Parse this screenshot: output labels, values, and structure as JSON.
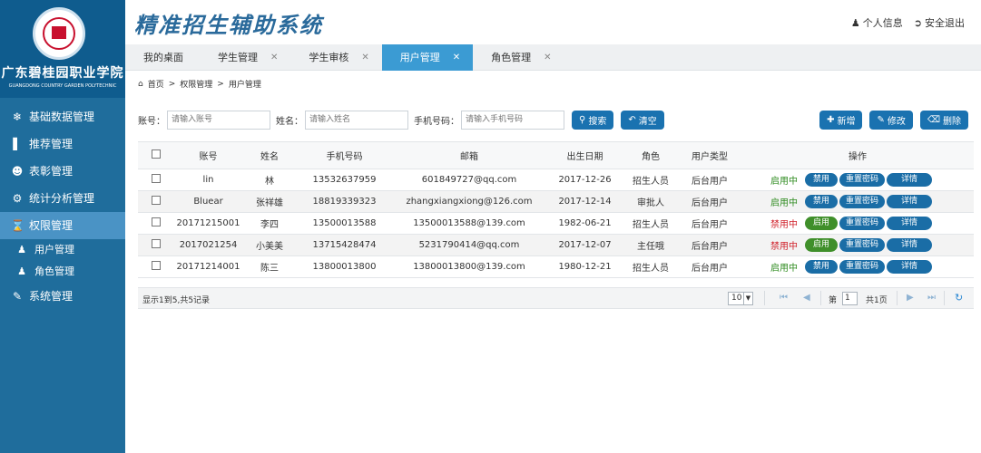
{
  "app": {
    "title": "精准招生辅助系统",
    "logo_cn": "广东碧桂园职业学院",
    "logo_en": "GUANGDONG COUNTRY GARDEN POLYTECHNIC"
  },
  "header": {
    "profile": "个人信息",
    "logout": "安全退出"
  },
  "sidebar": {
    "items": [
      {
        "label": "基础数据管理",
        "icon": "globe-icon"
      },
      {
        "label": "推荐管理",
        "icon": "bar-chart-icon"
      },
      {
        "label": "表彰管理",
        "icon": "users-icon"
      },
      {
        "label": "统计分析管理",
        "icon": "gear-icon"
      },
      {
        "label": "权限管理",
        "icon": "hourglass-icon"
      }
    ],
    "subitems": [
      {
        "label": "用户管理",
        "icon": "user-icon"
      },
      {
        "label": "角色管理",
        "icon": "user-edit-icon"
      }
    ],
    "last": {
      "label": "系统管理",
      "icon": "edit-icon"
    }
  },
  "tabs": [
    {
      "label": "我的桌面",
      "closable": false
    },
    {
      "label": "学生管理",
      "closable": true
    },
    {
      "label": "学生审核",
      "closable": true
    },
    {
      "label": "用户管理",
      "closable": true,
      "active": true
    },
    {
      "label": "角色管理",
      "closable": true
    }
  ],
  "breadcrumb": [
    "首页",
    "权限管理",
    "用户管理"
  ],
  "search": {
    "account_label": "账号：",
    "account_placeholder": "请输入账号",
    "name_label": "姓名：",
    "name_placeholder": "请输入姓名",
    "phone_label": "手机号码：",
    "phone_placeholder": "请输入手机号码",
    "search_btn": "搜索",
    "clear_btn": "清空",
    "add_btn": "新增",
    "edit_btn": "修改",
    "delete_btn": "删除"
  },
  "table": {
    "headers": [
      "账号",
      "姓名",
      "手机号码",
      "邮箱",
      "出生日期",
      "角色",
      "用户类型",
      "操作"
    ],
    "rows": [
      {
        "account": "lin",
        "name": "林",
        "phone": "13532637959",
        "email": "601849727@qq.com",
        "birth": "2017-12-26",
        "role": "招生人员",
        "type": "后台用户",
        "status": "启用中",
        "toggle": "禁用",
        "active": true
      },
      {
        "account": "Bluear",
        "name": "张祥雄",
        "phone": "18819339323",
        "email": "zhangxiangxiong@126.com",
        "birth": "2017-12-14",
        "role": "审批人",
        "type": "后台用户",
        "status": "启用中",
        "toggle": "禁用",
        "active": true
      },
      {
        "account": "20171215001",
        "name": "李四",
        "phone": "13500013588",
        "email": "13500013588@139.com",
        "birth": "1982-06-21",
        "role": "招生人员",
        "type": "后台用户",
        "status": "禁用中",
        "toggle": "启用",
        "active": false
      },
      {
        "account": "2017021254",
        "name": "小美美",
        "phone": "13715428474",
        "email": "5231790414@qq.com",
        "birth": "2017-12-07",
        "role": "主任哦",
        "type": "后台用户",
        "status": "禁用中",
        "toggle": "启用",
        "active": false
      },
      {
        "account": "20171214001",
        "name": "陈三",
        "phone": "13800013800",
        "email": "13800013800@139.com",
        "birth": "1980-12-21",
        "role": "招生人员",
        "type": "后台用户",
        "status": "启用中",
        "toggle": "禁用",
        "active": true
      }
    ],
    "reset_pwd": "重置密码",
    "detail": "详情"
  },
  "pager": {
    "info": "显示1到5,共5记录",
    "page_size": "10",
    "page_prefix": "第",
    "page_value": "1",
    "total": "共1页"
  }
}
